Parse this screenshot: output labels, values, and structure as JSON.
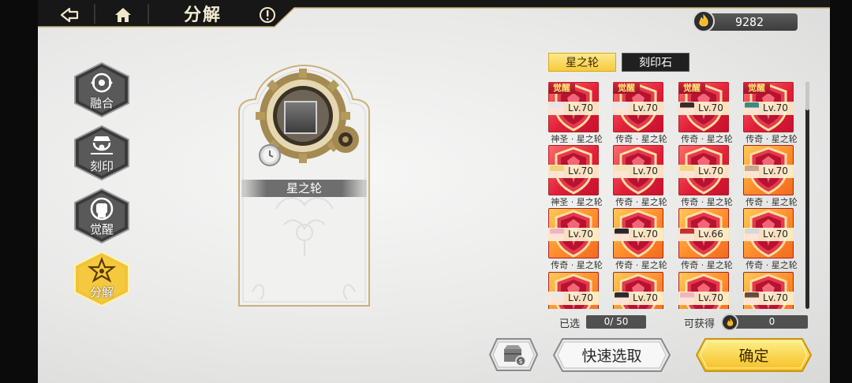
{
  "topbar": {
    "title": "分解",
    "back_icon": "back-arrow-icon",
    "home_icon": "home-icon",
    "info_icon": "info-icon",
    "currency_icon": "flame-coin-icon",
    "currency_value": "9282"
  },
  "sidebar": {
    "items": [
      {
        "label": "融合",
        "icon": "fusion-icon",
        "active": false
      },
      {
        "label": "刻印",
        "icon": "engrave-icon",
        "active": false
      },
      {
        "label": "觉醒",
        "icon": "awaken-fist-icon",
        "active": false
      },
      {
        "label": "分解",
        "icon": "decompose-star-icon",
        "active": true
      }
    ]
  },
  "selected_card": {
    "name": "星之轮",
    "slot_icon": "empty-slot-icon",
    "gear_icon": "gear-icon",
    "clock_icon": "clock-icon"
  },
  "tabs": [
    {
      "label": "星之轮",
      "active": true
    },
    {
      "label": "刻印石",
      "active": false
    }
  ],
  "items": [
    {
      "badge": "觉醒",
      "level": "Lv.70",
      "caption": "神圣 · 星之轮",
      "color": "red",
      "hair": "#e6e2ee"
    },
    {
      "badge": "觉醒",
      "level": "Lv.70",
      "caption": "传奇 · 星之轮",
      "color": "red",
      "hair": "#e9e6ec"
    },
    {
      "badge": "觉醒",
      "level": "Lv.70",
      "caption": "传奇 · 星之轮",
      "color": "red",
      "hair": "#3a2a2a"
    },
    {
      "badge": "觉醒",
      "level": "Lv.70",
      "caption": "传奇 · 星之轮",
      "color": "red",
      "hair": "#3b8a86"
    },
    {
      "badge": "",
      "level": "Lv.70",
      "caption": "神圣 · 星之轮",
      "color": "red",
      "hair": "#f1d27a"
    },
    {
      "badge": "",
      "level": "Lv.70",
      "caption": "传奇 · 星之轮",
      "color": "red",
      "hair": "#f3e3b4"
    },
    {
      "badge": "",
      "level": "Lv.70",
      "caption": "传奇 · 星之轮",
      "color": "red",
      "hair": "#f4d67e"
    },
    {
      "badge": "",
      "level": "Lv.70",
      "caption": "传奇 · 星之轮",
      "color": "orange",
      "hair": "#c9a98a"
    },
    {
      "badge": "",
      "level": "Lv.70",
      "caption": "传奇 · 星之轮",
      "color": "orange",
      "hair": "#f2b3c4"
    },
    {
      "badge": "",
      "level": "Lv.70",
      "caption": "传奇 · 星之轮",
      "color": "orange",
      "hair": "#2b2430"
    },
    {
      "badge": "",
      "level": "Lv.66",
      "caption": "传奇 · 星之轮",
      "color": "orange",
      "hair": "#c43030"
    },
    {
      "badge": "",
      "level": "Lv.70",
      "caption": "传奇 · 星之轮",
      "color": "orange",
      "hair": "#d7d7dc"
    },
    {
      "badge": "",
      "level": "Lv.70",
      "caption": "",
      "color": "orange",
      "hair": "#e8e8ef"
    },
    {
      "badge": "",
      "level": "Lv.70",
      "caption": "",
      "color": "orange",
      "hair": "#2c2a30"
    },
    {
      "badge": "",
      "level": "Lv.70",
      "caption": "",
      "color": "orange",
      "hair": "#f1b5c2"
    },
    {
      "badge": "",
      "level": "Lv.70",
      "caption": "",
      "color": "orange",
      "hair": "#6a4a3a"
    }
  ],
  "selection": {
    "selected_label": "已选",
    "selected_value": "0/ 50",
    "obtain_label": "可获得",
    "obtain_value": "0",
    "obtain_icon": "flame-coin-icon"
  },
  "buttons": {
    "shop_icon": "chest-coin-icon",
    "quick_select": "快速选取",
    "confirm": "确定"
  },
  "colors": {
    "accent_gold": "#f6cb3c",
    "dark_panel": "#202020",
    "card_red": "#e21f3a",
    "card_orange": "#ff8a2a"
  }
}
